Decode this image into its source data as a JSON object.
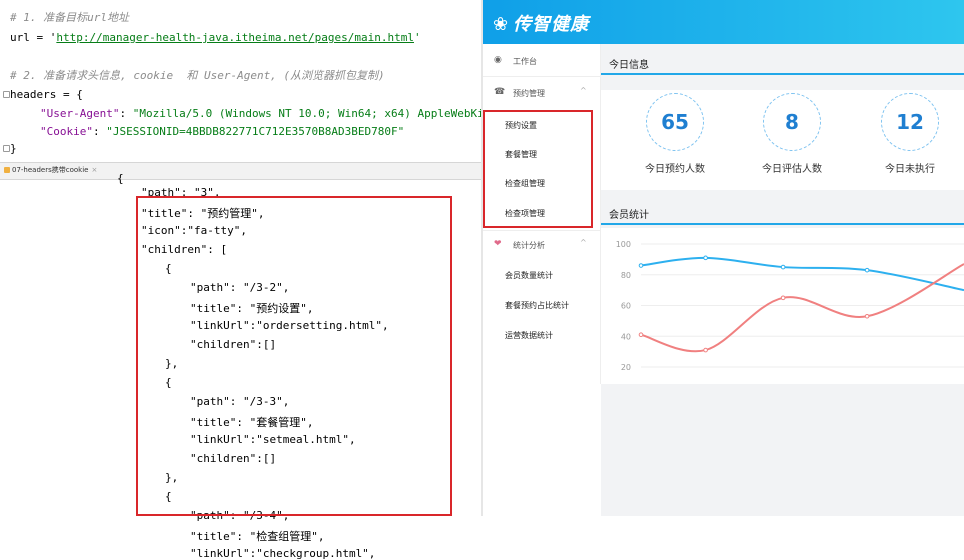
{
  "editor": {
    "line1_comment": "# 1. 准备目标url地址",
    "line2_prefix": "url = '",
    "line2_url": "http://manager-health-java.itheima.net/pages/main.html",
    "line2_suffix": "'",
    "line3_comment": "# 2. 准备请求头信息, cookie  和 User-Agent, (从浏览器抓包复制)",
    "line4": "headers = {",
    "line5_key": "\"User-Agent\"",
    "line5_colon": ": ",
    "line5_val": "\"Mozilla/5.0 (Windows NT 10.0; Win64; x64) AppleWebKit",
    "line6_key": "\"Cookie\"",
    "line6_colon": ": ",
    "line6_val": "\"JSESSIONID=4BBDB822771C712E3570B8AD3BED780F\"",
    "line7": "}",
    "tab_label": "07-headers携带cookie",
    "tab_close": "×"
  },
  "json_code": [
    "\"path\": \"3\",",
    "\"title\": \"预约管理\",",
    "\"icon\":\"fa-tty\",",
    "\"children\": [",
    "{",
    "\"path\": \"/3-2\",",
    "\"title\": \"预约设置\",",
    "\"linkUrl\":\"ordersetting.html\",",
    "\"children\":[]",
    "},",
    "{",
    "\"path\": \"/3-3\",",
    "\"title\": \"套餐管理\",",
    "\"linkUrl\":\"setmeal.html\",",
    "\"children\":[]",
    "},",
    "{",
    "\"path\": \"/3-4\",",
    "\"title\": \"检查组管理\",",
    "\"linkUrl\":\"checkgroup.html\","
  ],
  "app": {
    "logo": "传智健康",
    "logo_mark": "❀",
    "menu": {
      "workbench": "工作台",
      "appointment": "预约管理",
      "appointment_items": [
        "预约设置",
        "套餐管理",
        "检查组管理",
        "检查项管理"
      ],
      "statistics": "统计分析",
      "statistics_items": [
        "会员数量统计",
        "套餐预约占比统计",
        "运营数据统计"
      ],
      "chevron": "^"
    },
    "today_title": "今日信息",
    "stats": [
      {
        "value": "65",
        "label": "今日预约人数"
      },
      {
        "value": "8",
        "label": "今日评估人数"
      },
      {
        "value": "12",
        "label": "今日未执行"
      }
    ],
    "member_title": "会员统计"
  },
  "chart_data": {
    "type": "line",
    "y_ticks": [
      "100",
      "80",
      "60",
      "40",
      "20"
    ],
    "ylim": [
      20,
      100
    ],
    "grid": true,
    "series": [
      {
        "color": "#2db0ef",
        "points": [
          [
            0.0,
            86
          ],
          [
            0.2,
            91
          ],
          [
            0.44,
            85
          ],
          [
            0.7,
            83
          ],
          [
            1.0,
            70
          ]
        ]
      },
      {
        "color": "#f08080",
        "points": [
          [
            0.0,
            41
          ],
          [
            0.2,
            31
          ],
          [
            0.44,
            65
          ],
          [
            0.7,
            53
          ],
          [
            1.0,
            87
          ]
        ]
      }
    ]
  },
  "colors": {
    "accent": "#22a7e8",
    "highlight_box": "#d9262a"
  }
}
